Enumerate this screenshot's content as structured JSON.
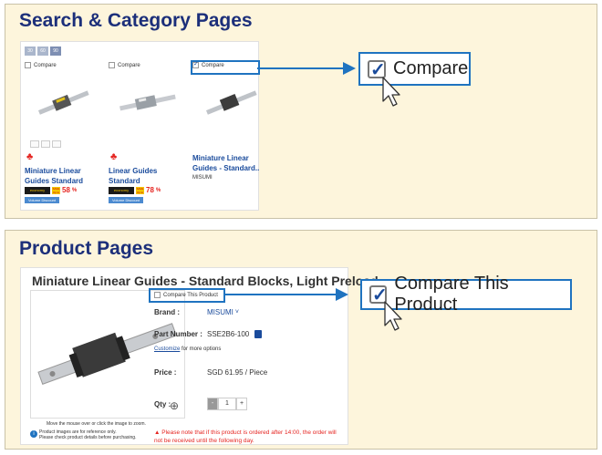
{
  "section1": {
    "title": "Search & Category Pages",
    "view_toggle": [
      "30",
      "60",
      "90"
    ],
    "cards": [
      {
        "compare_label": "Compare",
        "checked": false,
        "name": "Miniature Linear Guides Standard",
        "maker": "",
        "save": "SAVE",
        "upto": "Up to",
        "pct": "58",
        "pct_unit": "%",
        "economy": "economy",
        "volume_discount": "Volume Discount"
      },
      {
        "compare_label": "Compare",
        "checked": false,
        "name": "Linear Guides Standard",
        "maker": "",
        "save": "SAVE",
        "upto": "Up to",
        "pct": "78",
        "pct_unit": "%",
        "economy": "economy",
        "volume_discount": "Volume Discount"
      },
      {
        "compare_label": "Compare",
        "checked": true,
        "name": "Miniature Linear Guides - Standard..",
        "maker": "MISUMI"
      }
    ],
    "callout_label": "Compare"
  },
  "section2": {
    "title": "Product Pages",
    "product_title": "Miniature Linear Guides - Standard Blocks, Light Preload",
    "compare_label": "Compare This Product",
    "callout_label": "Compare This Product",
    "brand_label": "Brand :",
    "brand_value": "MISUMI",
    "part_label": "Part Number :",
    "part_value": "SSE2B6-100",
    "customize_link": "Customize",
    "customize_text": " for more options",
    "price_label": "Price :",
    "price_value": "SGD 61.95 / Piece",
    "qty_label": "Qty :",
    "qty_value": "1",
    "qty_minus": "-",
    "qty_plus": "+",
    "zoom_note": "Move the mouse over or click the image to zoom.",
    "ref_note1": "Product images are for reference only.",
    "ref_note2": "Please check product details before purchasing.",
    "warning": "Please note that if this product is ordered after 14:00, the order will not be received until the following day."
  },
  "colors": {
    "accent": "#1f73c0",
    "title": "#1c2f7a",
    "panel_bg": "#fdf5dc",
    "link": "#1a4b9c",
    "warn": "#e52420"
  },
  "icons": [
    "checkbox-icon",
    "cursor-icon",
    "zoom-icon",
    "copy-icon",
    "info-icon",
    "chevron-down-icon",
    "brand-logo-icon"
  ]
}
